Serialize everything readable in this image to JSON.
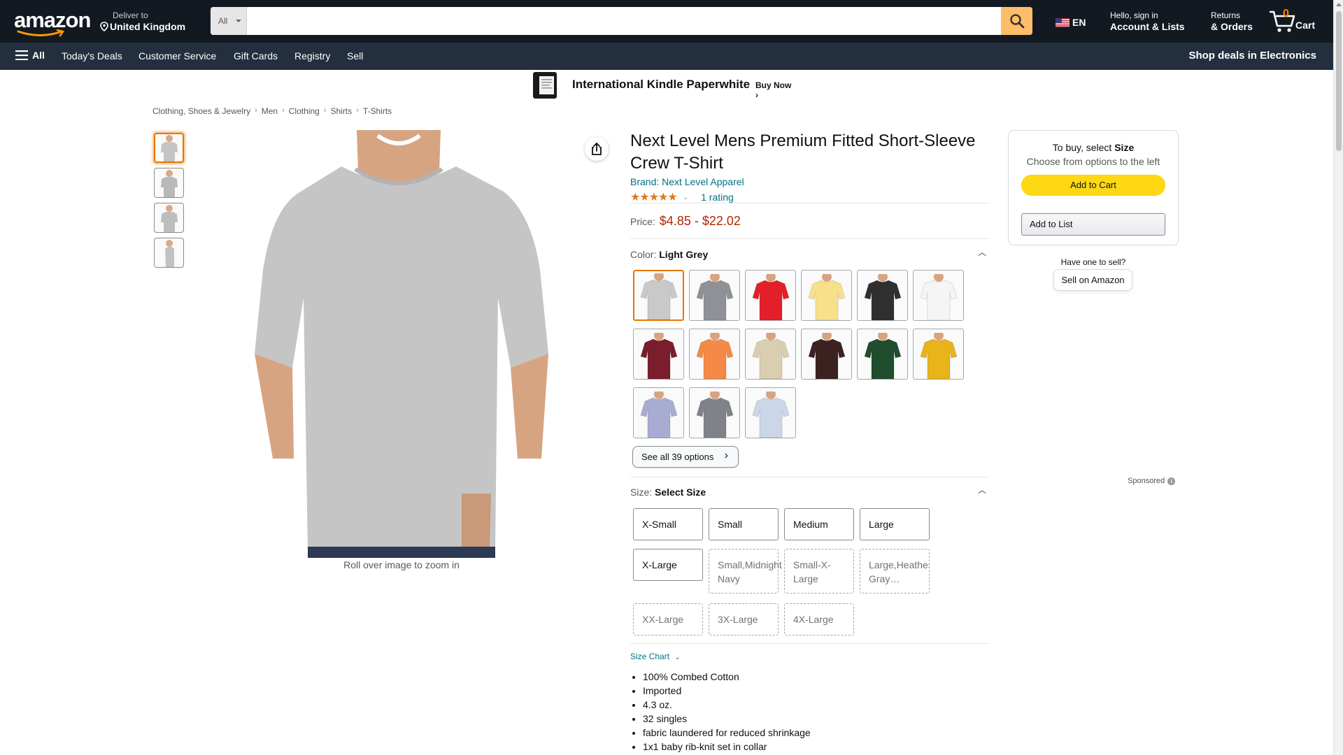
{
  "header": {
    "logo_text": "amazon",
    "deliver_line1": "Deliver to",
    "deliver_line2": "United Kingdom",
    "search_category": "All",
    "search_placeholder": "",
    "lang": "EN",
    "account_line1": "Hello, sign in",
    "account_line2": "Account & Lists",
    "returns_line1": "Returns",
    "returns_line2": "& Orders",
    "cart_count": "0",
    "cart_label": "Cart"
  },
  "nav": {
    "all_label": "All",
    "links": [
      "Today's Deals",
      "Customer Service",
      "Gift Cards",
      "Registry",
      "Sell"
    ],
    "promo": "Shop deals in Electronics"
  },
  "promo_banner": {
    "title": "International Kindle Paperwhite",
    "cta": "Buy Now ›"
  },
  "breadcrumb": [
    "Clothing, Shoes & Jewelry",
    "Men",
    "Clothing",
    "Shirts",
    "T-Shirts"
  ],
  "gallery": {
    "zoom_hint": "Roll over image to zoom in",
    "thumb_count": 4
  },
  "product": {
    "title": "Next Level Mens Premium Fitted Short-Sleeve Crew T-Shirt",
    "brand": "Brand: Next Level Apparel",
    "stars": "★★★★★",
    "rating_count": "1 rating",
    "price_label": "Price:",
    "price_value": "$4.85 - $22.02"
  },
  "color_section": {
    "label": "Color:",
    "selected": "Light Grey",
    "see_all": "See all 39 options",
    "swatch_colors": [
      "#c9c9c9",
      "#8e9196",
      "#e3202a",
      "#f7e08a",
      "#2f2f2f",
      "#f5f5f5",
      "#7a1d2d",
      "#f48a45",
      "#d9ceaf",
      "#3b2220",
      "#1f4d2e",
      "#e8b419",
      "#a9acd2",
      "#7f8288",
      "#cbd6e8"
    ],
    "selected_index": 0
  },
  "size_section": {
    "label": "Size:",
    "selected": "Select Size",
    "available": [
      "X-Small",
      "Small",
      "Medium",
      "Large",
      "X-Large"
    ],
    "unavailable": [
      "Small,Midnight Navy",
      "Small-X-Large",
      "Large,Heather Gray…",
      "XX-Large",
      "3X-Large",
      "4X-Large"
    ]
  },
  "size_chart": "Size Chart",
  "bullets": [
    "100% Combed Cotton",
    "Imported",
    "4.3 oz.",
    "32 singles",
    "fabric laundered for reduced shrinkage",
    "1x1 baby rib-knit set in collar"
  ],
  "buybox": {
    "line1_prefix": "To buy, select ",
    "line1_bold": "Size",
    "line2": "Choose from options to the left",
    "add_cart": "Add to Cart",
    "add_list": "Add to List",
    "sell_q": "Have one to sell?",
    "sell_btn": "Sell on Amazon",
    "sponsored": "Sponsored"
  },
  "colors": {
    "header_bg": "#131921",
    "nav_bg": "#232f3e",
    "accent": "#febd69",
    "price": "#b12704",
    "link": "#007185"
  }
}
